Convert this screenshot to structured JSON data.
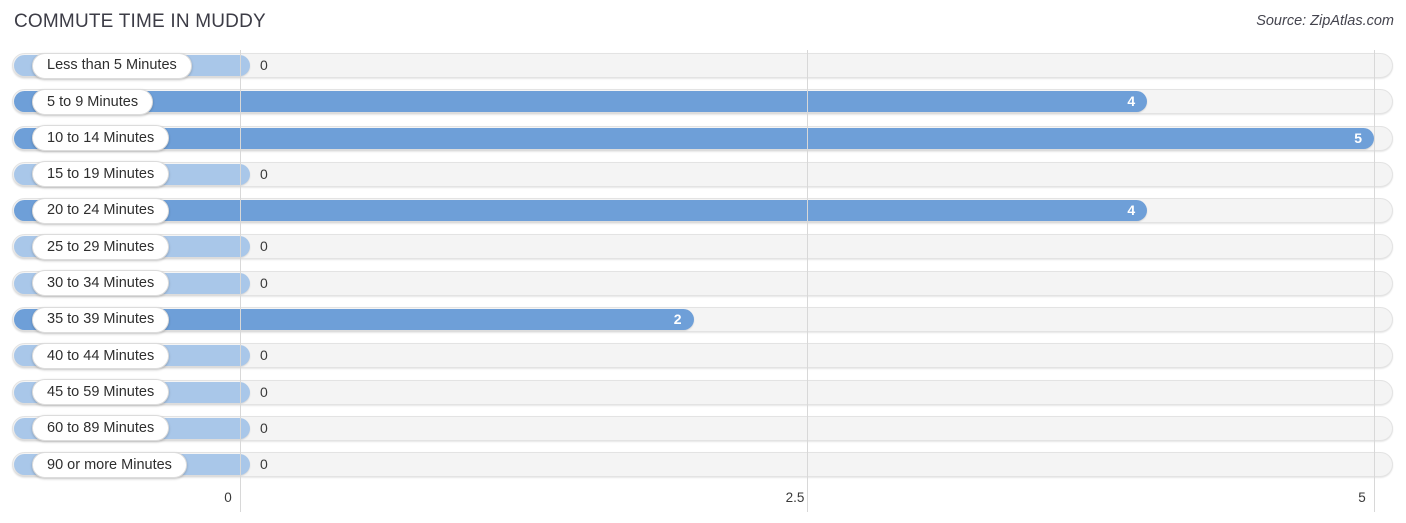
{
  "header": {
    "title": "COMMUTE TIME IN MUDDY",
    "source": "Source: ZipAtlas.com"
  },
  "chart_data": {
    "type": "bar",
    "orientation": "horizontal",
    "title": "COMMUTE TIME IN MUDDY",
    "xlabel": "",
    "ylabel": "",
    "xlim": [
      0,
      5
    ],
    "grid": true,
    "legend": "none",
    "ticks": [
      "0",
      "2.5",
      "5"
    ],
    "tick_values": [
      0,
      2.5,
      5
    ],
    "categories": [
      "Less than 5 Minutes",
      "5 to 9 Minutes",
      "10 to 14 Minutes",
      "15 to 19 Minutes",
      "20 to 24 Minutes",
      "25 to 29 Minutes",
      "30 to 34 Minutes",
      "35 to 39 Minutes",
      "40 to 44 Minutes",
      "45 to 59 Minutes",
      "60 to 89 Minutes",
      "90 or more Minutes"
    ],
    "values": [
      0,
      4,
      5,
      0,
      4,
      0,
      0,
      2,
      0,
      0,
      0,
      0
    ],
    "value_labels": [
      "0",
      "4",
      "5",
      "0",
      "4",
      "0",
      "0",
      "2",
      "0",
      "0",
      "0",
      "0"
    ],
    "colors": {
      "bar_positive": "#6e9fd8",
      "bar_zero": "#a9c7e9",
      "track": "#f4f4f4",
      "gridline": "#d8d8d8",
      "label_pill": "#ffffff",
      "text": "#2e2e2e"
    }
  }
}
